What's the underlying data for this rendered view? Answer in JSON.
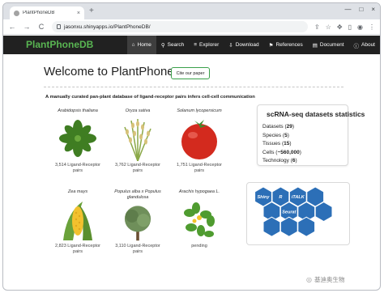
{
  "browser": {
    "tab_title": "PlantPhoneDB",
    "tab_close": "×",
    "new_tab": "+",
    "url": "jasonxu.shinyapps.io/PlantPhoneDB/",
    "back": "←",
    "forward": "→",
    "reload": "C",
    "window_controls": [
      "—",
      "□",
      "×"
    ],
    "toolbar_icons": [
      "share-icon",
      "star-icon",
      "extensions-icon",
      "sidebar-icon",
      "profile-icon",
      "menu-icon"
    ]
  },
  "site": {
    "brand": "PlantPhoneDB",
    "nav": [
      {
        "label": "Home",
        "icon": "home-icon",
        "glyph": "⌂",
        "active": true
      },
      {
        "label": "Search",
        "icon": "search-icon",
        "glyph": "⚲",
        "active": false
      },
      {
        "label": "Explorer",
        "icon": "explorer-icon",
        "glyph": "≡",
        "active": false
      },
      {
        "label": "Download",
        "icon": "download-icon",
        "glyph": "⇩",
        "active": false
      },
      {
        "label": "References",
        "icon": "references-icon",
        "glyph": "⚑",
        "active": false
      },
      {
        "label": "Document",
        "icon": "document-icon",
        "glyph": "▤",
        "active": false
      },
      {
        "label": "About",
        "icon": "about-icon",
        "glyph": "ⓘ",
        "active": false
      }
    ]
  },
  "main": {
    "welcome": "Welcome to PlantPhoneDB!",
    "cite_button": "Cite our paper",
    "subtitle": "A manually curated pan-plant database of ligand-receptor pairs infers cell-cell communication"
  },
  "species": [
    {
      "name": "Arabidopsis thaliana",
      "pairs": "3,514 Ligand-Receptor pairs",
      "image": "arabidopsis"
    },
    {
      "name": "Oryza sativa",
      "pairs": "3,762 Ligand-Receptor pairs",
      "image": "rice"
    },
    {
      "name": "Solanum lycopersicum",
      "pairs": "1,751 Ligand-Receptor pairs",
      "image": "tomato"
    },
    {
      "name": "Zea mays",
      "pairs": "2,823 Ligand-Receptor pairs",
      "image": "maize"
    },
    {
      "name": "Populus alba x Populus glandulosa",
      "pairs": "3,110 Ligand-Receptor pairs",
      "image": "poplar"
    },
    {
      "name": "Arachis hypogaea L.",
      "pairs": "pending",
      "image": "peanut"
    }
  ],
  "stats": {
    "title": "scRNA-seq datasets statistics",
    "items": [
      {
        "label": "Datasets",
        "value": "29"
      },
      {
        "label": "Species",
        "value": "5"
      },
      {
        "label": "Tissues",
        "value": "15"
      },
      {
        "label": "Cells",
        "value": "~560,000"
      },
      {
        "label": "Technology",
        "value": "6"
      }
    ]
  },
  "tools": [
    {
      "label": "Shiny",
      "color": "#2c6fb7"
    },
    {
      "label": "R",
      "color": "#2c6fb7"
    },
    {
      "label": "iTALK",
      "color": "#2c6fb7"
    },
    {
      "label": "",
      "color": "#2c6fb7"
    },
    {
      "label": "",
      "color": "#2c6fb7"
    },
    {
      "label": "Seurat",
      "color": "#2c6fb7"
    },
    {
      "label": "",
      "color": "#2c6fb7"
    },
    {
      "label": "",
      "color": "#2c6fb7"
    },
    {
      "label": "",
      "color": "#2c6fb7"
    },
    {
      "label": "",
      "color": "#2c6fb7"
    },
    {
      "label": "",
      "color": "#2c6fb7"
    }
  ],
  "watermark": {
    "text": "基迪奥生物",
    "icon": "wechat-icon"
  },
  "colors": {
    "brand": "#59b552",
    "navbar": "#212121",
    "cite_border": "#3aa04a",
    "hex": "#2c6fb7"
  }
}
